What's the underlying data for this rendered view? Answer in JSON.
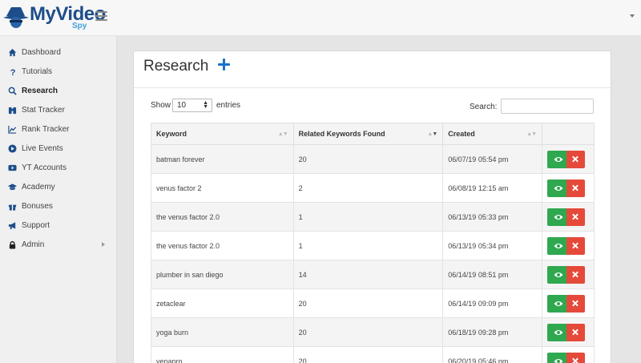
{
  "logo": {
    "text": "MyVideo",
    "sub": "Spy"
  },
  "sidebar": {
    "items": [
      {
        "label": "Dashboard",
        "icon": "home-icon"
      },
      {
        "label": "Tutorials",
        "icon": "question-icon"
      },
      {
        "label": "Research",
        "icon": "search-icon",
        "active": true
      },
      {
        "label": "Stat Tracker",
        "icon": "binoculars-icon"
      },
      {
        "label": "Rank Tracker",
        "icon": "line-chart-icon"
      },
      {
        "label": "Live Events",
        "icon": "play-circle-icon"
      },
      {
        "label": "YT Accounts",
        "icon": "youtube-icon"
      },
      {
        "label": "Academy",
        "icon": "graduation-cap-icon"
      },
      {
        "label": "Bonuses",
        "icon": "gift-icon"
      },
      {
        "label": "Support",
        "icon": "bullhorn-icon"
      },
      {
        "label": "Admin",
        "icon": "lock-icon",
        "has_submenu": true
      }
    ]
  },
  "page": {
    "title": "Research"
  },
  "controls": {
    "show_label": "Show",
    "entries_value": "10",
    "entries_label": "entries",
    "search_label": "Search:"
  },
  "table": {
    "headers": [
      "Keyword",
      "Related Keywords Found",
      "Created"
    ],
    "rows": [
      {
        "keyword": "batman forever",
        "related": "20",
        "created": "06/07/19 05:54 pm"
      },
      {
        "keyword": "venus factor 2",
        "related": "2",
        "created": "06/08/19 12:15 am"
      },
      {
        "keyword": "the venus factor 2.0",
        "related": "1",
        "created": "06/13/19 05:33 pm"
      },
      {
        "keyword": "the venus factor 2.0",
        "related": "1",
        "created": "06/13/19 05:34 pm"
      },
      {
        "keyword": "plumber in san diego",
        "related": "14",
        "created": "06/14/19 08:51 pm"
      },
      {
        "keyword": "zetaclear",
        "related": "20",
        "created": "06/14/19 09:09 pm"
      },
      {
        "keyword": "yoga burn",
        "related": "20",
        "created": "06/18/19 09:28 pm"
      },
      {
        "keyword": "venapro",
        "related": "20",
        "created": "06/20/19 05:46 pm"
      }
    ]
  },
  "colors": {
    "view_button": "#2fa84f",
    "delete_button": "#e5493a",
    "brand": "#1d4e89",
    "plus": "#1a72c9"
  }
}
